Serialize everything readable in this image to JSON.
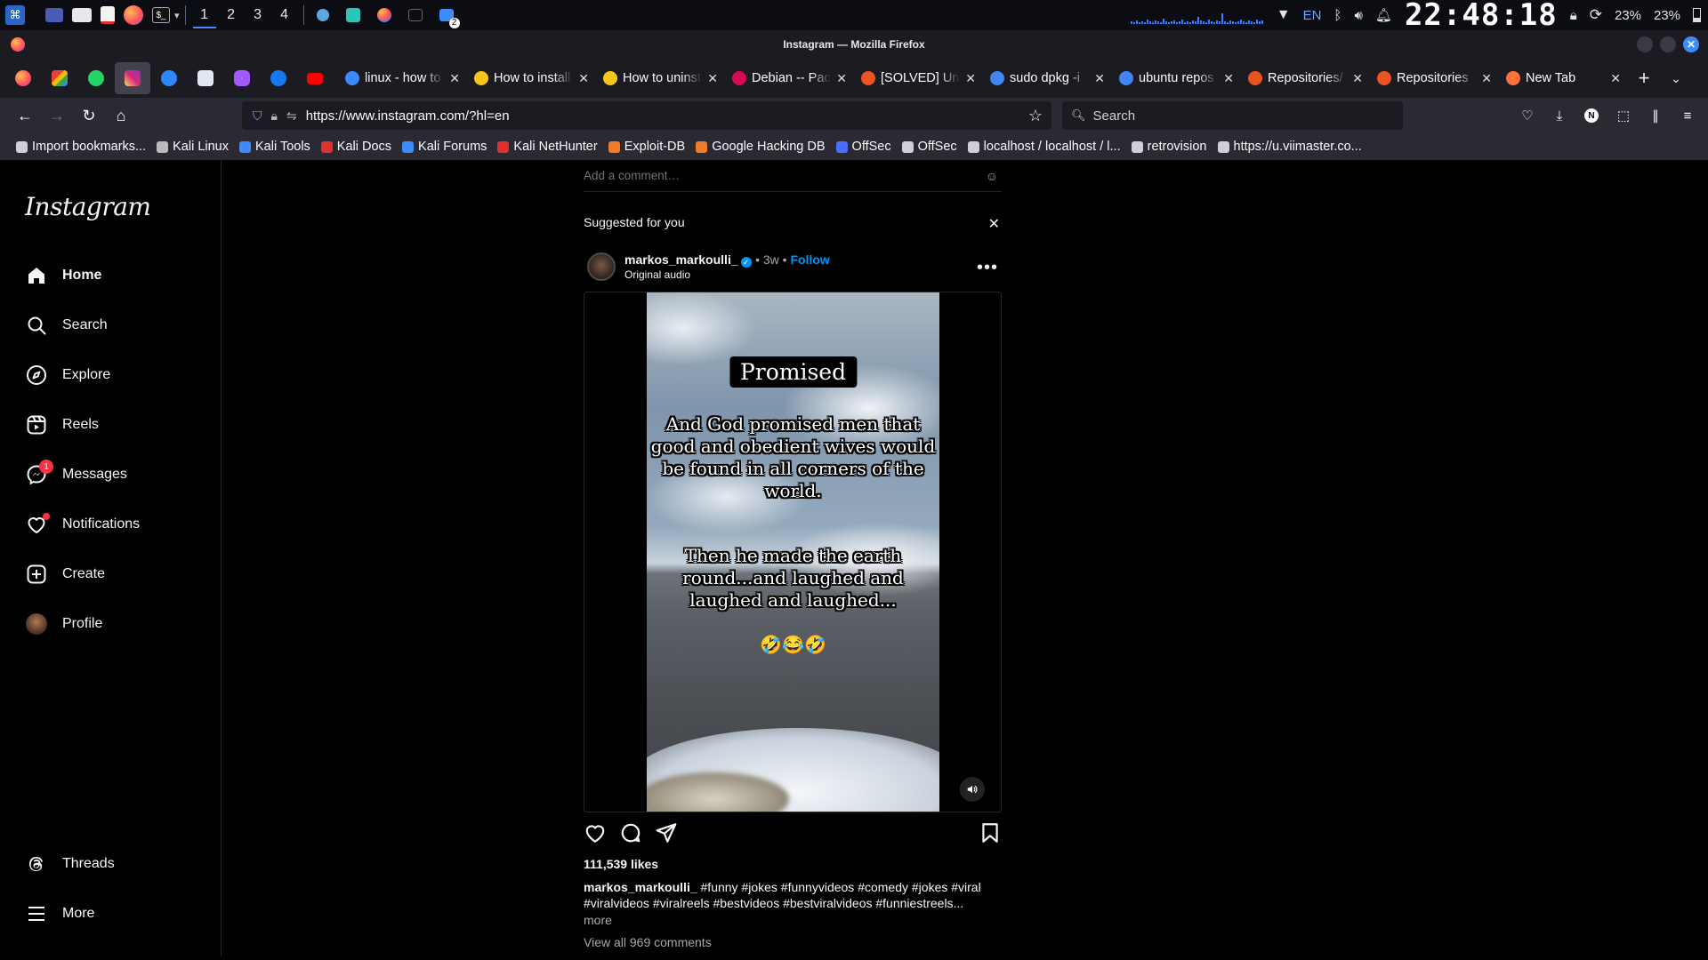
{
  "os_panel": {
    "workspaces": [
      "1",
      "2",
      "3",
      "4"
    ],
    "active_workspace": "1",
    "notification_count": "2",
    "language": "EN",
    "clock": "22:48:18",
    "cpu_percent": "23%",
    "battery_percent": "23%",
    "accent_color": "#3d8bff"
  },
  "window": {
    "title": "Instagram — Mozilla Firefox"
  },
  "tabs": [
    {
      "label": "linux - how to",
      "icon": "vscode-icon",
      "color": "#3d8bff"
    },
    {
      "label": "How to install",
      "icon": "warning-icon",
      "color": "#f5c518"
    },
    {
      "label": "How to uninstall",
      "icon": "warning-icon",
      "color": "#f5c518"
    },
    {
      "label": "Debian -- Package",
      "icon": "debian-icon",
      "color": "#d70a53"
    },
    {
      "label": "[SOLVED] Unable",
      "icon": "ubuntu-icon",
      "color": "#e95420"
    },
    {
      "label": "sudo dpkg -i",
      "icon": "google-icon",
      "color": "#4285f4"
    },
    {
      "label": "ubuntu repos",
      "icon": "google-icon",
      "color": "#4285f4"
    },
    {
      "label": "Repositories/",
      "icon": "ubuntu-icon",
      "color": "#e95420"
    },
    {
      "label": "Repositories",
      "icon": "ubuntu-icon",
      "color": "#e95420"
    },
    {
      "label": "New Tab",
      "icon": "firefox-icon",
      "color": "#ff7139"
    }
  ],
  "navbar": {
    "url": "https://www.instagram.com/?hl=en",
    "search_placeholder": "Search"
  },
  "bookmarks": [
    {
      "label": "Import bookmarks...",
      "color": "#cfcfd8"
    },
    {
      "label": "Kali Linux",
      "color": "#bbbbbb"
    },
    {
      "label": "Kali Tools",
      "color": "#3d8bff"
    },
    {
      "label": "Kali Docs",
      "color": "#e0302f"
    },
    {
      "label": "Kali Forums",
      "color": "#3d8bff"
    },
    {
      "label": "Kali NetHunter",
      "color": "#e0302f"
    },
    {
      "label": "Exploit-DB",
      "color": "#f07b2a"
    },
    {
      "label": "Google Hacking DB",
      "color": "#f07b2a"
    },
    {
      "label": "OffSec",
      "color": "#4a6cff"
    },
    {
      "label": "OffSec",
      "color": "#cfcfd8"
    },
    {
      "label": "localhost / localhost / l...",
      "color": "#cfcfd8"
    },
    {
      "label": "retrovision",
      "color": "#cfcfd8"
    },
    {
      "label": "https://u.viimaster.co...",
      "color": "#cfcfd8"
    }
  ],
  "instagram": {
    "logo": "Instagram",
    "nav": [
      {
        "label": "Home",
        "icon": "home-icon"
      },
      {
        "label": "Search",
        "icon": "search-icon"
      },
      {
        "label": "Explore",
        "icon": "compass-icon"
      },
      {
        "label": "Reels",
        "icon": "reels-icon"
      },
      {
        "label": "Messages",
        "icon": "messenger-icon",
        "badge": "1"
      },
      {
        "label": "Notifications",
        "icon": "heart-icon"
      },
      {
        "label": "Create",
        "icon": "plus-square-icon"
      },
      {
        "label": "Profile",
        "icon": "avatar"
      }
    ],
    "nav_bottom": [
      {
        "label": "Threads",
        "icon": "threads-icon"
      },
      {
        "label": "More",
        "icon": "menu-icon"
      }
    ],
    "feed": {
      "comment_placeholder": "Add a comment…",
      "suggested_label": "Suggested for you",
      "post": {
        "username": "markos_markoulli_",
        "age": "3w",
        "follow_label": "Follow",
        "audio": "Original audio",
        "video_title": "Promised",
        "video_text_1": "And God promised men that good and obedient wives would be found in all corners of the world.",
        "video_text_2": "Then he made the earth round...and laughed and laughed and laughed...",
        "video_emoji": "🤣😂🤣",
        "likes": "111,539 likes",
        "caption_user": "markos_markoulli_",
        "caption_text": "#funny #jokes #funnyvideos #comedy #jokes #viral #viralvideos #viralreels #bestvideos #bestviralvideos #funniestreels...",
        "more_label": "more",
        "view_comments": "View all 969 comments"
      }
    }
  }
}
